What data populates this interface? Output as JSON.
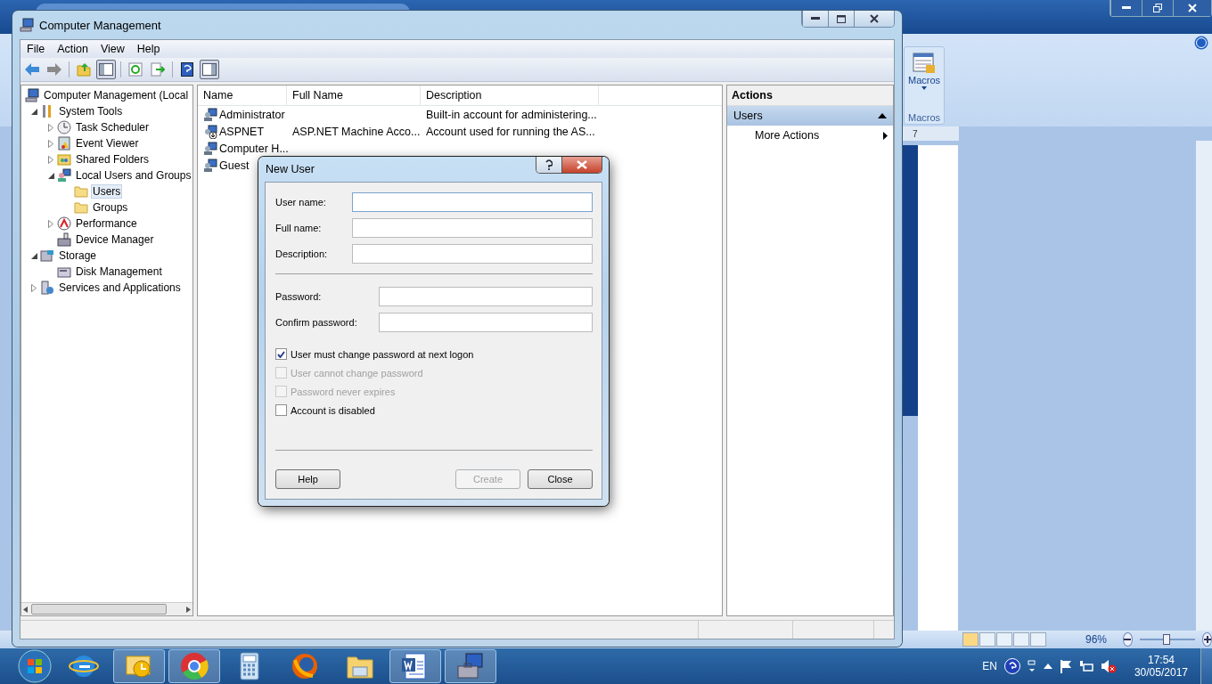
{
  "word_window": {
    "macros_button": "Macros",
    "macros_group": "Macros",
    "ruler_label": "7",
    "zoom_text": "96%",
    "zoom_slider": {
      "level": 0.48
    }
  },
  "computer_management": {
    "title": "Computer Management",
    "menu": [
      "File",
      "Action",
      "View",
      "Help"
    ],
    "tree": [
      {
        "label": "Computer Management (Local",
        "kind": "computer",
        "selected": false,
        "children": [
          {
            "label": "System Tools",
            "kind": "tools",
            "selected": false,
            "expanded": true,
            "children": [
              {
                "label": "Task Scheduler",
                "kind": "clock",
                "selected": false,
                "expanded": false
              },
              {
                "label": "Event Viewer",
                "kind": "event",
                "selected": false,
                "expanded": false
              },
              {
                "label": "Shared Folders",
                "kind": "share",
                "selected": false,
                "expanded": false
              },
              {
                "label": "Local Users and Groups",
                "kind": "users",
                "selected": false,
                "expanded": true,
                "children": [
                  {
                    "label": "Users",
                    "kind": "folder",
                    "selected": true
                  },
                  {
                    "label": "Groups",
                    "kind": "folder",
                    "selected": false
                  }
                ]
              },
              {
                "label": "Performance",
                "kind": "perf",
                "selected": false,
                "expanded": false
              },
              {
                "label": "Device Manager",
                "kind": "device",
                "selected": false
              }
            ]
          },
          {
            "label": "Storage",
            "kind": "storage",
            "selected": false,
            "expanded": true,
            "children": [
              {
                "label": "Disk Management",
                "kind": "disk",
                "selected": false
              }
            ]
          },
          {
            "label": "Services and Applications",
            "kind": "services",
            "selected": false,
            "expanded": false
          }
        ]
      }
    ],
    "columns": [
      "Name",
      "Full Name",
      "Description"
    ],
    "rows": [
      {
        "kind": "user",
        "name": "Administrator",
        "full_name": "",
        "description": "Built-in account for administering..."
      },
      {
        "kind": "service",
        "name": "ASPNET",
        "full_name": "ASP.NET Machine Acco...",
        "description": "Account used for running the AS..."
      },
      {
        "kind": "user",
        "name": "Computer H...",
        "full_name": "",
        "description": ""
      },
      {
        "kind": "user",
        "name": "Guest",
        "full_name": "",
        "description": ""
      }
    ],
    "actions": {
      "title": "Actions",
      "section": {
        "label": "Users",
        "expanded": true
      },
      "items": [
        "More Actions"
      ]
    }
  },
  "new_user_dialog": {
    "title": "New User",
    "field_groups": [
      [
        {
          "label": "User name:"
        },
        {
          "label": "Full name:"
        },
        {
          "label": "Description:"
        }
      ],
      [
        {
          "label": "Password:"
        },
        {
          "label": "Confirm password:"
        }
      ]
    ],
    "checkboxes": [
      {
        "label": "User must change password at next logon",
        "checked": true,
        "disabled": false
      },
      {
        "label": "User cannot change password",
        "checked": false,
        "disabled": true
      },
      {
        "label": "Password never expires",
        "checked": false,
        "disabled": true
      },
      {
        "label": "Account is disabled",
        "checked": false,
        "disabled": false
      }
    ],
    "buttons": [
      {
        "label": "Help",
        "disabled": false
      },
      {
        "label": "Create",
        "disabled": true
      },
      {
        "label": "Close",
        "disabled": false
      }
    ]
  },
  "taskbar": {
    "apps": [
      {
        "kind": "ie",
        "running": false
      },
      {
        "kind": "mail",
        "running": true
      },
      {
        "kind": "chrome",
        "running": true
      },
      {
        "kind": "calculator",
        "running": false
      },
      {
        "kind": "firefox",
        "running": false
      },
      {
        "kind": "explorer",
        "running": false
      },
      {
        "kind": "word",
        "running": true
      },
      {
        "kind": "toolbox",
        "running": true
      }
    ],
    "language": "EN",
    "time": "17:54",
    "date": "30/05/2017"
  }
}
